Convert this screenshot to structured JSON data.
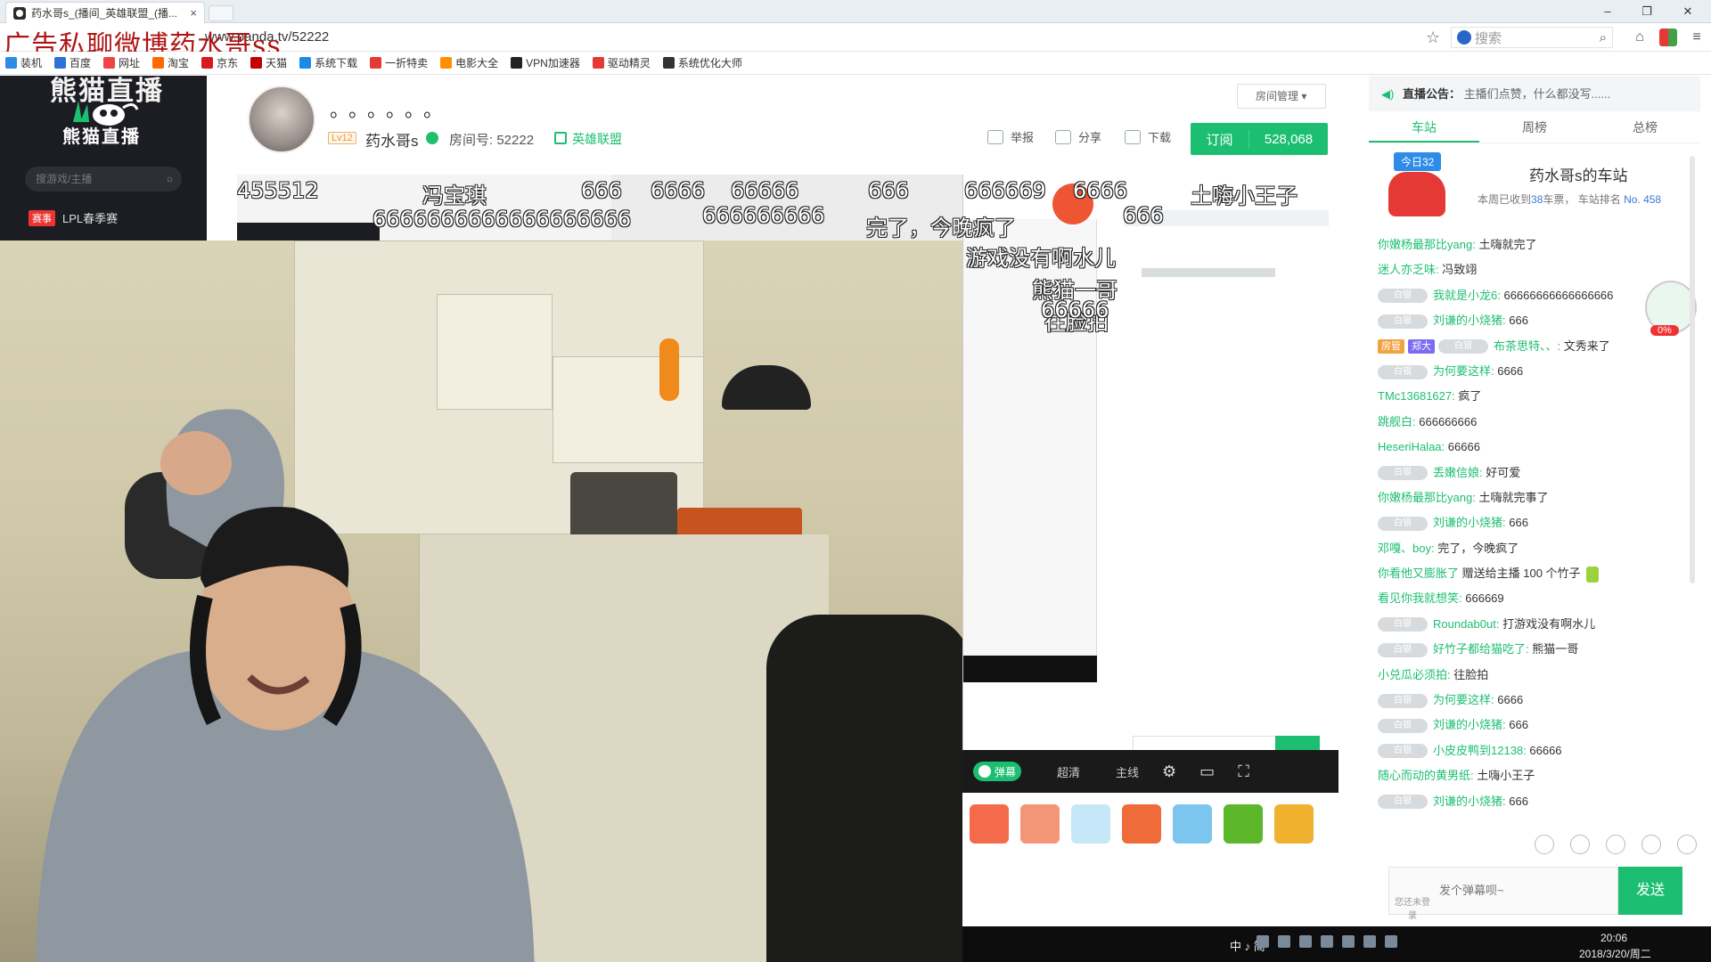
{
  "browser": {
    "tab_title": "药水哥s_(播间_英雄联盟_(播...",
    "url": "www.panda.tv/52222",
    "search_placeholder": "搜索",
    "ad_overlay": "广告私聊微博药水哥ss",
    "bookmarks": [
      {
        "label": "装机",
        "color": "#2e8be6"
      },
      {
        "label": "百度",
        "color": "#2f6fd6"
      },
      {
        "label": "网址",
        "color": "#e44"
      },
      {
        "label": "淘宝",
        "color": "#ff6a00"
      },
      {
        "label": "京东",
        "color": "#d71920"
      },
      {
        "label": "天猫",
        "color": "#c40000"
      },
      {
        "label": "系统下载",
        "color": "#1e88e5"
      },
      {
        "label": "一折特卖",
        "color": "#e53935"
      },
      {
        "label": "电影大全",
        "color": "#ff8f00"
      },
      {
        "label": "VPN加速器",
        "color": "#222"
      },
      {
        "label": "驱动精灵",
        "color": "#e53935"
      },
      {
        "label": "系统优化大师",
        "color": "#333"
      }
    ]
  },
  "site": {
    "brand_top": "熊猫直播",
    "logo_text": "熊猫直播",
    "search_placeholder": "搜游戏/主播",
    "nav_tag": "赛事",
    "nav_item": "LPL春季赛"
  },
  "room": {
    "title": "。。。。。。",
    "level": "Lv12",
    "streamer": "药水哥s",
    "room_no": "房间号: 52222",
    "category": "英雄联盟",
    "manage": "房间管理",
    "report": "举报",
    "share": "分享",
    "download": "下载",
    "subscribe": "订阅",
    "subscribers": "528,068"
  },
  "danmaku": [
    {
      "text": "455512"
    },
    {
      "text": "冯宝琪"
    },
    {
      "text": "666"
    },
    {
      "text": "6666"
    },
    {
      "text": "66666"
    },
    {
      "text": "666"
    },
    {
      "text": "666669"
    },
    {
      "text": "6666"
    },
    {
      "text": "土嗨小王子"
    },
    {
      "text": "6666666666666666666"
    },
    {
      "text": "666666666"
    },
    {
      "text": "完了，今晚疯了"
    },
    {
      "text": "666"
    },
    {
      "text": "游戏没有啊水儿"
    },
    {
      "text": "熊猫一哥"
    },
    {
      "text": "往脸拍"
    },
    {
      "text": "66666"
    }
  ],
  "player_controls": {
    "danmu": "弹幕",
    "quality": "超清",
    "line": "主线"
  },
  "chat": {
    "notice_label": "直播公告：",
    "notice_text": "主播们点赞，什么都没写......",
    "tabs": [
      "车站",
      "周榜",
      "总榜"
    ],
    "today_badge": "今日32",
    "station_title": "药水哥s的车站",
    "station_sub_pre": "本周已收到",
    "station_sub_count": "38",
    "station_sub_mid": "车票， 车站排名",
    "station_sub_rank": "No. 458",
    "panda_pct": "0%",
    "messages": [
      {
        "user": "你嫩杨最那比yang:",
        "text": "土嗨就完了"
      },
      {
        "user": "迷人亦乏味:",
        "text": "冯致翊"
      },
      {
        "badge": "白银",
        "user": "我就是小龙6:",
        "text": "66666666666666666"
      },
      {
        "badge": "白银",
        "user": "刘谦的小烧猪:",
        "text": "666"
      },
      {
        "lv": "房管",
        "lv2": "郑大",
        "badge": "白银",
        "user": "布茶思特、、:",
        "text": "文秀来了"
      },
      {
        "badge": "白银",
        "user": "为何要这样:",
        "text": "6666"
      },
      {
        "user": "TMc13681627:",
        "text": "疯了"
      },
      {
        "user": "跳舰白:",
        "text": "666666666"
      },
      {
        "user": "HeseriHalaa:",
        "text": "66666"
      },
      {
        "badge": "白银",
        "user": "丢嫩信娘:",
        "text": "好可爱"
      },
      {
        "user": "你嫩杨最那比yang:",
        "text": "土嗨就完事了"
      },
      {
        "badge": "白银",
        "user": "刘谦的小烧猪:",
        "text": "666"
      },
      {
        "user": "邓嘎、boy:",
        "text": "完了，今晚疯了"
      },
      {
        "user": "你看他又膨胀了",
        "text": "赠送给主播 100 个竹子",
        "gift": true
      },
      {
        "user": "看见你我就想笑:",
        "text": "666669"
      },
      {
        "badge": "白银",
        "user": "Roundab0ut:",
        "text": "打游戏没有啊水儿"
      },
      {
        "badge": "白银",
        "user": "好竹子都给猫吃了:",
        "text": "熊猫一哥"
      },
      {
        "user": "小兑瓜必须拍:",
        "text": "往脸拍"
      },
      {
        "badge": "白银",
        "user": "为何要这样:",
        "text": "6666"
      },
      {
        "badge": "白银",
        "user": "刘谦的小烧猪:",
        "text": "666"
      },
      {
        "badge": "白银",
        "user": "小皮皮鸭到12138:",
        "text": "66666"
      },
      {
        "user": "随心而动的黄男纸:",
        "text": "土嗨小王子"
      },
      {
        "badge": "白银",
        "user": "刘谦的小烧猪:",
        "text": "666"
      }
    ],
    "login_hint": "您还未登录",
    "input_placeholder": "发个弹幕呗~",
    "send": "发送"
  },
  "taskbar": {
    "ime": "中 ♪ 简",
    "time": "20:06",
    "date": "2018/3/20/周二"
  }
}
